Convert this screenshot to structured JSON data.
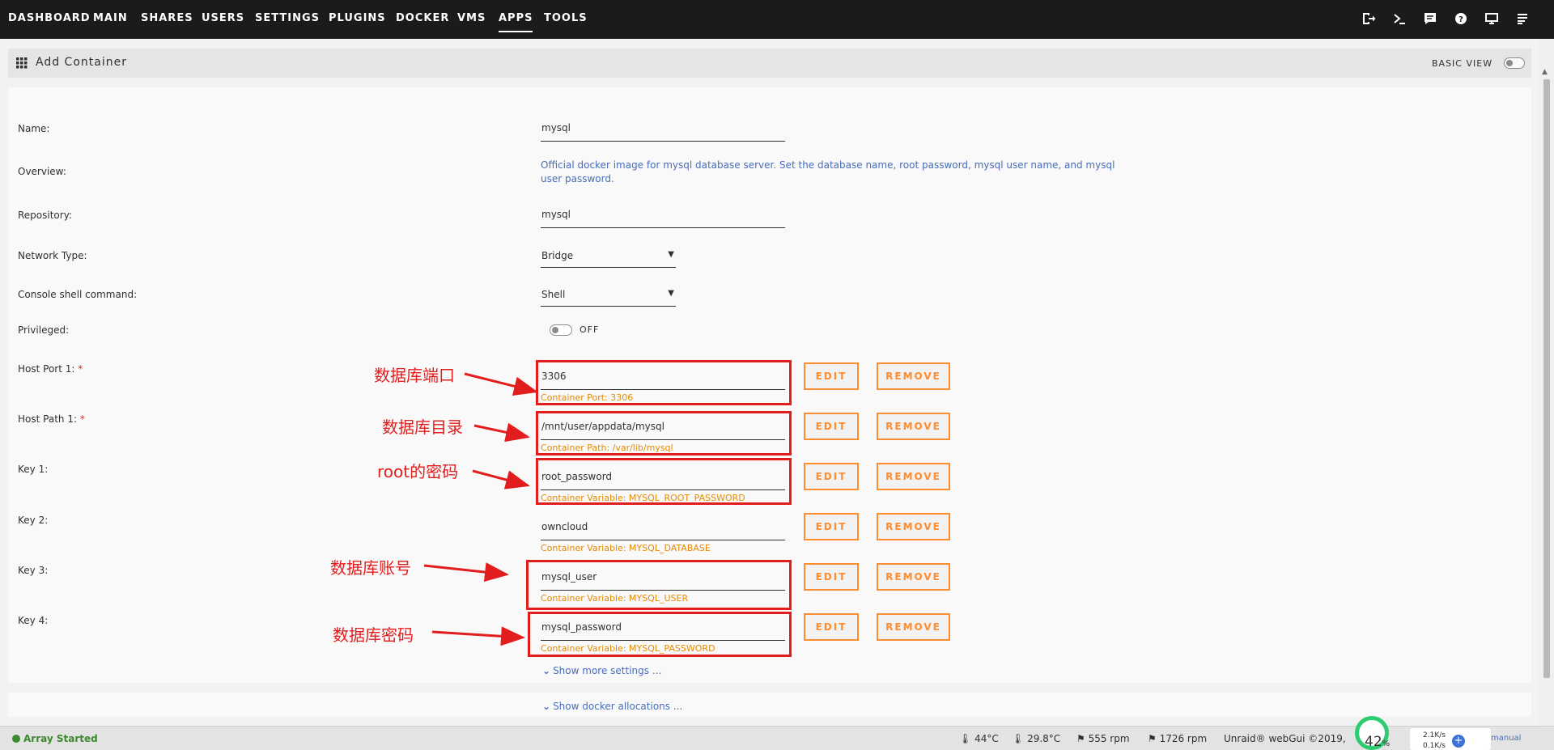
{
  "nav": {
    "tabs": [
      "DASHBOARD",
      "MAIN",
      "SHARES",
      "USERS",
      "SETTINGS",
      "PLUGINS",
      "DOCKER",
      "VMS",
      "APPS",
      "TOOLS"
    ],
    "active": "APPS",
    "icons": [
      "logout-icon",
      "terminal-icon",
      "feedback-icon",
      "help-icon",
      "monitor-icon",
      "log-icon"
    ]
  },
  "page": {
    "title": "Add Container",
    "basic_view_label": "BASIC VIEW"
  },
  "form": {
    "name_label": "Name:",
    "name_value": "mysql",
    "overview_label": "Overview:",
    "overview_text": "Official docker image for mysql database server. Set the database name, root password, mysql user name, and mysql user password.",
    "repository_label": "Repository:",
    "repository_value": "mysql",
    "network_label": "Network Type:",
    "network_value": "Bridge",
    "console_label": "Console shell command:",
    "console_value": "Shell",
    "privileged_label": "Privileged:",
    "privileged_value": "OFF",
    "required_mark": "*",
    "edit_label": "EDIT",
    "remove_label": "REMOVE",
    "config": [
      {
        "label": "Host Port 1:",
        "required": true,
        "value": "3306",
        "hint": "Container Port: 3306"
      },
      {
        "label": "Host Path 1:",
        "required": true,
        "value": "/mnt/user/appdata/mysql",
        "hint": "Container Path: /var/lib/mysql"
      },
      {
        "label": "Key 1:",
        "required": false,
        "value": "root_password",
        "hint": "Container Variable: MYSQL_ROOT_PASSWORD"
      },
      {
        "label": "Key 2:",
        "required": false,
        "value": "owncloud",
        "hint": "Container Variable: MYSQL_DATABASE"
      },
      {
        "label": "Key 3:",
        "required": false,
        "value": "mysql_user",
        "hint": "Container Variable: MYSQL_USER"
      },
      {
        "label": "Key 4:",
        "required": false,
        "value": "mysql_password",
        "hint": "Container Variable: MYSQL_PASSWORD"
      }
    ],
    "show_more": "Show more settings ...",
    "show_docker": "Show docker allocations ..."
  },
  "annotations": [
    "数据库端口",
    "数据库目录",
    "root的密码",
    "数据库账号",
    "数据库密码"
  ],
  "status": {
    "array": "Array Started",
    "temp_cpu": "44°C",
    "temp_mb": "29.8°C",
    "fan1": "555 rpm",
    "fan2": "1726 rpm",
    "copyright": "Unraid® webGui ©2019,",
    "manual": "manual",
    "speed_pct": "42",
    "speed_pct_unit": "%",
    "speed_up": "2.1K/s",
    "speed_down": "0.1K/s"
  },
  "colors": {
    "accent": "#ff8c2f",
    "annotation": "#e21d1d",
    "link": "#486dba",
    "hint": "#e68a00"
  }
}
